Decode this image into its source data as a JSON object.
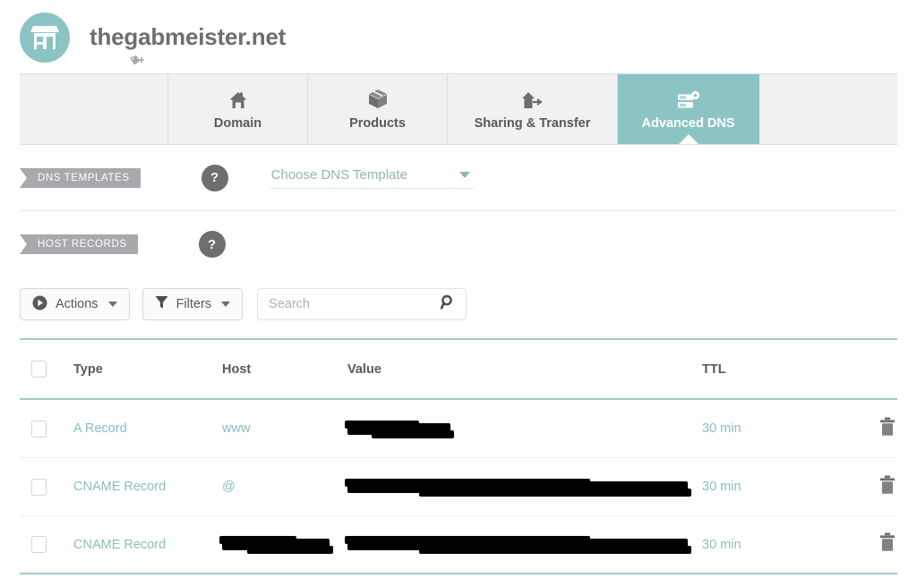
{
  "header": {
    "domain_title": "thegabmeister.net",
    "avatar_icon": "storefront-icon",
    "add_tag_icon": "tag-plus-icon",
    "accent_color": "#8cc4c4"
  },
  "tabs": [
    {
      "label": "Domain",
      "icon": "house-icon",
      "active": false
    },
    {
      "label": "Products",
      "icon": "box-icon",
      "active": false
    },
    {
      "label": "Sharing & Transfer",
      "icon": "house-arrow-icon",
      "active": false
    },
    {
      "label": "Advanced DNS",
      "icon": "server-gear-icon",
      "active": true
    }
  ],
  "sections": {
    "dns_templates": {
      "ribbon_label": "DNS TEMPLATES",
      "help_label": "?",
      "select_value": "Choose DNS Template"
    },
    "host_records": {
      "ribbon_label": "HOST RECORDS",
      "help_label": "?"
    }
  },
  "toolbar": {
    "actions_label": "Actions",
    "actions_icon": "play-circle-icon",
    "filters_label": "Filters",
    "filters_icon": "funnel-icon",
    "search_placeholder": "Search",
    "search_value": "",
    "search_icon": "magnifier-icon"
  },
  "table": {
    "columns": [
      "Type",
      "Host",
      "Value",
      "TTL"
    ],
    "rows": [
      {
        "type": "A Record",
        "host": "www",
        "host_redacted": false,
        "value": "",
        "value_redacted": true,
        "value_bar_width": 115,
        "ttl": "30 min",
        "delete_icon": "trash-icon"
      },
      {
        "type": "CNAME Record",
        "host": "@",
        "host_redacted": false,
        "value": "",
        "value_redacted": true,
        "value_bar_width": 380,
        "ttl": "30 min",
        "delete_icon": "trash-icon"
      },
      {
        "type": "CNAME Record",
        "host": "",
        "host_redacted": true,
        "value": "",
        "value_redacted": true,
        "value_bar_width": 380,
        "ttl": "30 min",
        "delete_icon": "trash-icon"
      }
    ]
  }
}
